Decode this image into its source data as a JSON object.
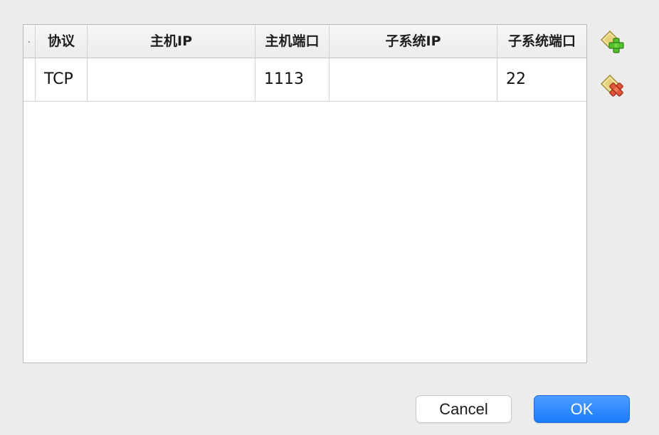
{
  "table": {
    "columns": [
      "",
      "协议",
      "主机IP",
      "主机端口",
      "子系统IP",
      "子系统端口"
    ],
    "rows": [
      {
        "protocol": "TCP",
        "host_ip": "",
        "host_port": "1113",
        "guest_ip": "",
        "guest_port": "22"
      }
    ]
  },
  "actions": {
    "add_icon": "add-rule-icon",
    "remove_icon": "remove-rule-icon",
    "add_color": "#53c22b",
    "remove_color": "#e0563a"
  },
  "buttons": {
    "cancel_label": "Cancel",
    "ok_label": "OK"
  },
  "colors": {
    "accent": "#1a7cfd",
    "background": "#ececec"
  }
}
